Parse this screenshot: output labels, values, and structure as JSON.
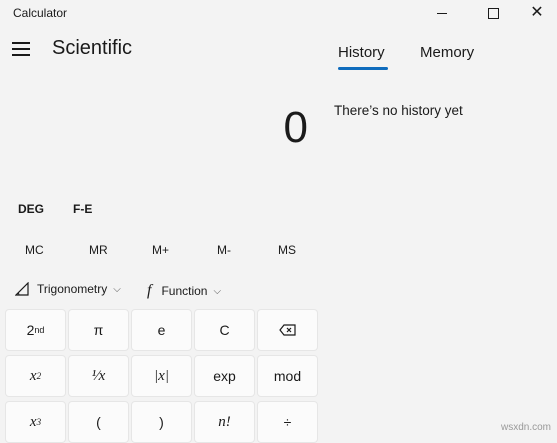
{
  "window": {
    "title": "Calculator"
  },
  "header": {
    "mode": "Scientific"
  },
  "display": {
    "value": "0"
  },
  "panel": {
    "tabs": [
      "History",
      "Memory"
    ],
    "active_tab": "History",
    "empty_message": "There’s no history yet"
  },
  "settings": {
    "deg": "DEG",
    "fe": "F-E"
  },
  "memory": [
    "MC",
    "MR",
    "M+",
    "M-",
    "MS"
  ],
  "functions": {
    "trigonometry": "Trigonometry",
    "function": "Function"
  },
  "keys": {
    "pi": "π",
    "e": "e",
    "clear": "C",
    "exp": "exp",
    "mod": "mod",
    "open_paren": "(",
    "close_paren": ")",
    "divide": "÷"
  },
  "watermark": "wsxdn.com",
  "colors": {
    "background": "#f3f3f3",
    "key_background": "#fbfbfb",
    "accent": "#0f6cbd"
  }
}
